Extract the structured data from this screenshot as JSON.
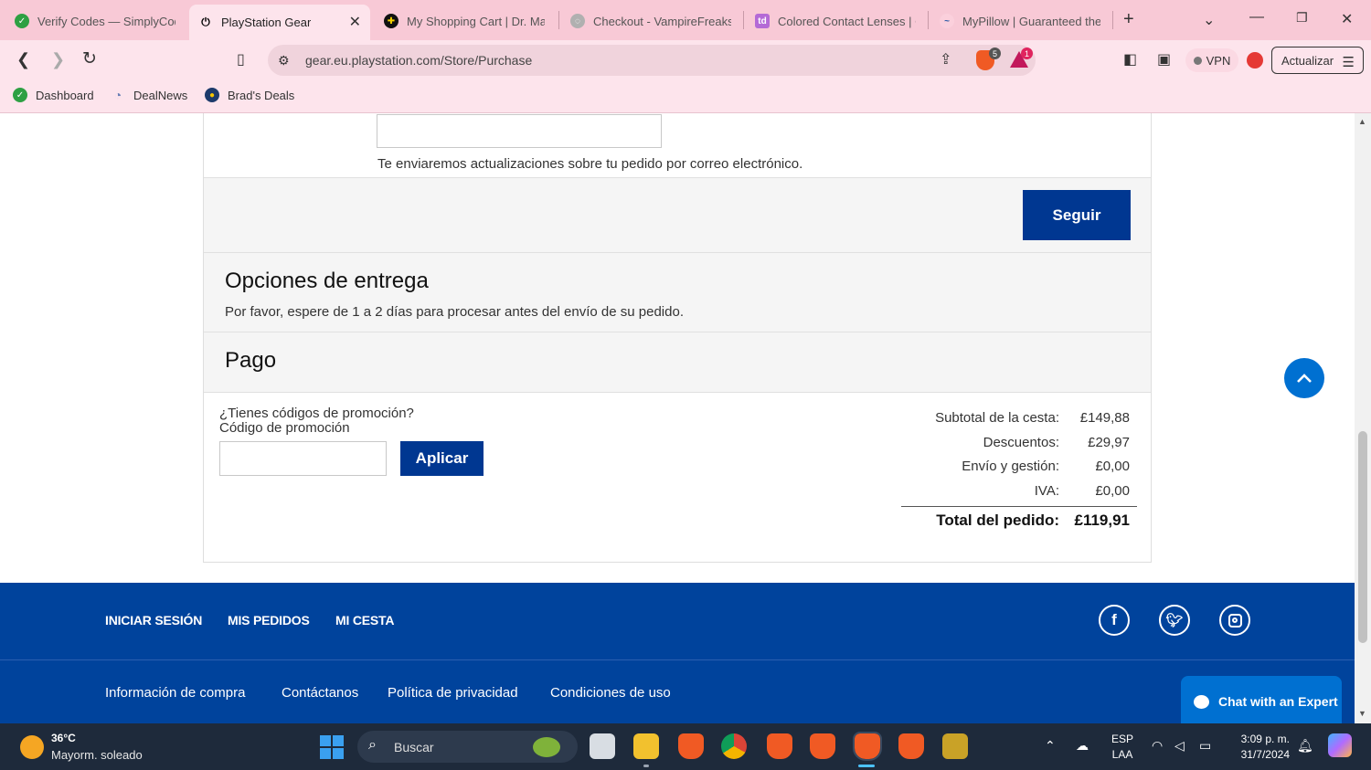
{
  "browser": {
    "tabs": [
      {
        "title": "Verify Codes — SimplyCodes",
        "icon_color": "#2ea043"
      },
      {
        "title": "PlayStation Gear",
        "icon_color": "#000000",
        "active": true
      },
      {
        "title": "My Shopping Cart | Dr. Martens",
        "icon_color": "#111111"
      },
      {
        "title": "Checkout - VampireFreaks",
        "icon_color": "#9a9a9a"
      },
      {
        "title": "Colored Contact Lenses | Colors",
        "icon_color": "#b46ad6"
      },
      {
        "title": "MyPillow | Guaranteed the Most",
        "icon_color": "#2b5aa8"
      }
    ],
    "new_tab_symbol": "+",
    "url": "gear.eu.playstation.com/Store/Purchase",
    "vpn_label": "VPN",
    "update_label": "Actualizar",
    "shield_badge": "5",
    "rewards_badge": "1",
    "bookmarks": [
      {
        "label": "Dashboard",
        "icon_color": "#2ea043"
      },
      {
        "label": "DealNews",
        "icon_color": "#6a7fb5"
      },
      {
        "label": "Brad's Deals",
        "icon_color": "#1d3a6b"
      }
    ]
  },
  "page": {
    "email_note": "Te enviaremos actualizaciones sobre tu pedido por correo electrónico.",
    "continue_label": "Seguir",
    "delivery": {
      "title": "Opciones de entrega",
      "note": "Por favor, espere de 1 a 2 días para procesar antes del envío de su pedido."
    },
    "payment": {
      "title": "Pago"
    },
    "promo": {
      "question": "¿Tienes códigos de promoción?",
      "label": "Código de promoción",
      "apply_label": "Aplicar"
    },
    "totals": {
      "subtotal_label": "Subtotal de la cesta:",
      "subtotal_value": "£149,88",
      "discount_label": "Descuentos:",
      "discount_value": "£29,97",
      "shipping_label": "Envío y gestión:",
      "shipping_value": "£0,00",
      "tax_label": "IVA:",
      "tax_value": "£0,00",
      "total_label": "Total del pedido:",
      "total_value": "£119,91"
    },
    "accent_color": "#003791"
  },
  "footer": {
    "top_links": [
      "INICIAR SESIÓN",
      "MIS PEDIDOS",
      "MI CESTA"
    ],
    "bottom_links": [
      "Información de compra",
      "Contáctanos",
      "Política de privacidad",
      "Condiciones de uso"
    ],
    "social": [
      "facebook-icon",
      "twitter-icon",
      "instagram-icon"
    ],
    "chat_label": "Chat with an Expert",
    "background_color": "#00439c"
  },
  "taskbar": {
    "temperature": "36°C",
    "weather": "Mayorm. soleado",
    "search_placeholder": "Buscar",
    "lang_1": "ESP",
    "lang_2": "LAA",
    "time": "3:09 p. m.",
    "date": "31/7/2024"
  }
}
